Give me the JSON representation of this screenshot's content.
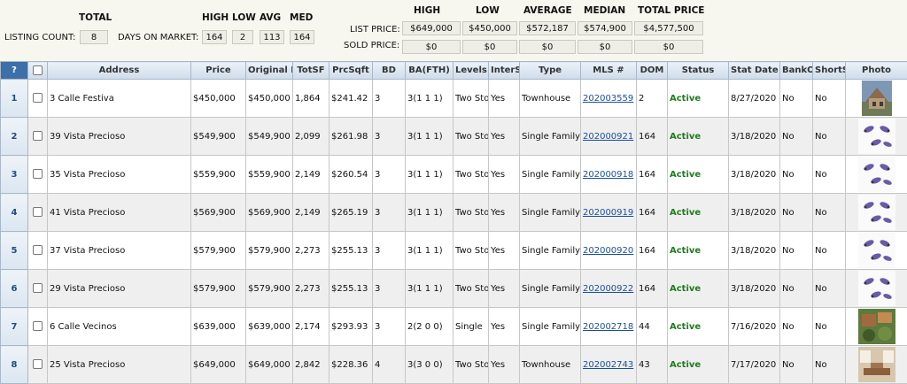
{
  "stats": {
    "total_label": "TOTAL",
    "listing_count_label": "LISTING COUNT:",
    "listing_count": "8",
    "high_label": "HIGH",
    "low_label": "LOW",
    "avg_label": "AVG",
    "med_label": "MED",
    "dom_label": "DAYS ON MARKET:",
    "dom_high": "164",
    "dom_low": "2",
    "dom_avg": "113",
    "dom_med": "164",
    "price_high_label": "HIGH",
    "price_low_label": "LOW",
    "price_average_label": "AVERAGE",
    "price_median_label": "MEDIAN",
    "price_total_label": "TOTAL PRICE",
    "list_price_label": "LIST PRICE:",
    "sold_price_label": "SOLD PRICE:",
    "list_high": "$649,000",
    "list_low": "$450,000",
    "list_average": "$572,187",
    "list_median": "$574,900",
    "list_total": "$4,577,500",
    "sold_high": "$0",
    "sold_low": "$0",
    "sold_average": "$0",
    "sold_median": "$0",
    "sold_total": "$0"
  },
  "table": {
    "columns": [
      "?",
      "",
      "Address",
      "Price",
      "Original P",
      "TotSF",
      "PrcSqft",
      "BD",
      "BA(FTH)",
      "Levels",
      "InterS",
      "Type",
      "MLS #",
      "DOM",
      "Status",
      "Stat Date",
      "BankO",
      "ShortS",
      "Photo"
    ],
    "rows": [
      {
        "n": "1",
        "address": "3 Calle Festiva",
        "price": "$450,000",
        "orig": "$450,000",
        "totsf": "1,864",
        "prcsqft": "$241.42",
        "bd": "3",
        "ba": "3(1 1 1)",
        "levels": "Two Sto",
        "inter": "Yes",
        "type": "Townhouse",
        "mls": "202003559",
        "dom": "2",
        "status": "Active",
        "date": "8/27/2020",
        "bank": "No",
        "short": "No"
      },
      {
        "n": "2",
        "address": "39 Vista Precioso",
        "price": "$549,900",
        "orig": "$549,900",
        "totsf": "2,099",
        "prcsqft": "$261.98",
        "bd": "3",
        "ba": "3(1 1 1)",
        "levels": "Two Sto",
        "inter": "Yes",
        "type": "Single Family",
        "mls": "202000921",
        "dom": "164",
        "status": "Active",
        "date": "3/18/2020",
        "bank": "No",
        "short": "No"
      },
      {
        "n": "3",
        "address": "35 Vista Precioso",
        "price": "$559,900",
        "orig": "$559,900",
        "totsf": "2,149",
        "prcsqft": "$260.54",
        "bd": "3",
        "ba": "3(1 1 1)",
        "levels": "Two Sto",
        "inter": "Yes",
        "type": "Single Family",
        "mls": "202000918",
        "dom": "164",
        "status": "Active",
        "date": "3/18/2020",
        "bank": "No",
        "short": "No"
      },
      {
        "n": "4",
        "address": "41 Vista Precioso",
        "price": "$569,900",
        "orig": "$569,900",
        "totsf": "2,149",
        "prcsqft": "$265.19",
        "bd": "3",
        "ba": "3(1 1 1)",
        "levels": "Two Sto",
        "inter": "Yes",
        "type": "Single Family",
        "mls": "202000919",
        "dom": "164",
        "status": "Active",
        "date": "3/18/2020",
        "bank": "No",
        "short": "No"
      },
      {
        "n": "5",
        "address": "37 Vista Precioso",
        "price": "$579,900",
        "orig": "$579,900",
        "totsf": "2,273",
        "prcsqft": "$255.13",
        "bd": "3",
        "ba": "3(1 1 1)",
        "levels": "Two Sto",
        "inter": "Yes",
        "type": "Single Family",
        "mls": "202000920",
        "dom": "164",
        "status": "Active",
        "date": "3/18/2020",
        "bank": "No",
        "short": "No"
      },
      {
        "n": "6",
        "address": "29 Vista Precioso",
        "price": "$579,900",
        "orig": "$579,900",
        "totsf": "2,273",
        "prcsqft": "$255.13",
        "bd": "3",
        "ba": "3(1 1 1)",
        "levels": "Two Sto",
        "inter": "Yes",
        "type": "Single Family",
        "mls": "202000922",
        "dom": "164",
        "status": "Active",
        "date": "3/18/2020",
        "bank": "No",
        "short": "No"
      },
      {
        "n": "7",
        "address": "6 Calle Vecinos",
        "price": "$639,000",
        "orig": "$639,000",
        "totsf": "2,174",
        "prcsqft": "$293.93",
        "bd": "3",
        "ba": "2(2 0 0)",
        "levels": "Single",
        "inter": "Yes",
        "type": "Single Family",
        "mls": "202002718",
        "dom": "44",
        "status": "Active",
        "date": "7/16/2020",
        "bank": "No",
        "short": "No"
      },
      {
        "n": "8",
        "address": "25 Vista Precioso",
        "price": "$649,000",
        "orig": "$649,000",
        "totsf": "2,842",
        "prcsqft": "$228.36",
        "bd": "4",
        "ba": "3(3 0 0)",
        "levels": "Two Sto",
        "inter": "Yes",
        "type": "Townhouse",
        "mls": "202002743",
        "dom": "43",
        "status": "Active",
        "date": "7/17/2020",
        "bank": "No",
        "short": "No"
      }
    ]
  },
  "photos": [
    "house-photo",
    "placeholder-logo",
    "placeholder-logo",
    "placeholder-logo",
    "placeholder-logo",
    "placeholder-logo",
    "yard-photo",
    "interior-photo"
  ],
  "colors": {
    "status_active": "#1e7d1e",
    "link": "#1a4f9e",
    "header_accent": "#3d6fa8"
  }
}
